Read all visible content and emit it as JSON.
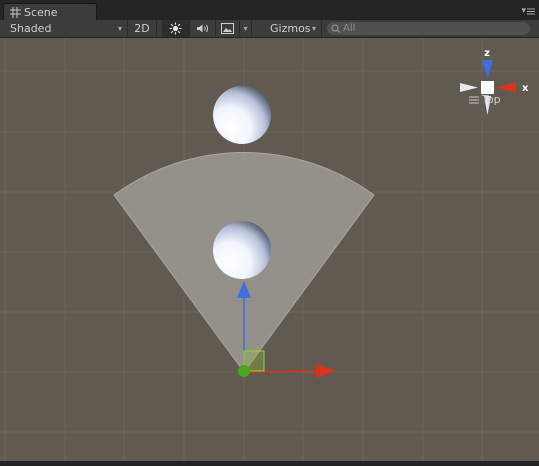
{
  "tab": {
    "title": "Scene",
    "icon": "scene-grid-icon"
  },
  "toolbar": {
    "draw_mode": "Shaded",
    "mode_2d": "2D",
    "lighting_icon": "sun-icon",
    "audio_icon": "speaker-icon",
    "effects_icon": "image-icon",
    "gizmos": "Gizmos",
    "search_placeholder": "All"
  },
  "gizmo": {
    "axis_z": "z",
    "axis_x": "x",
    "view_label": "Top",
    "menu_icon": "hamburger-icon"
  },
  "colors": {
    "background": "#615a51",
    "light_cone": "#9e9a94",
    "axis_y": "#3d6fe0",
    "axis_x": "#d9321d",
    "handle_green": "#8ec13b"
  }
}
